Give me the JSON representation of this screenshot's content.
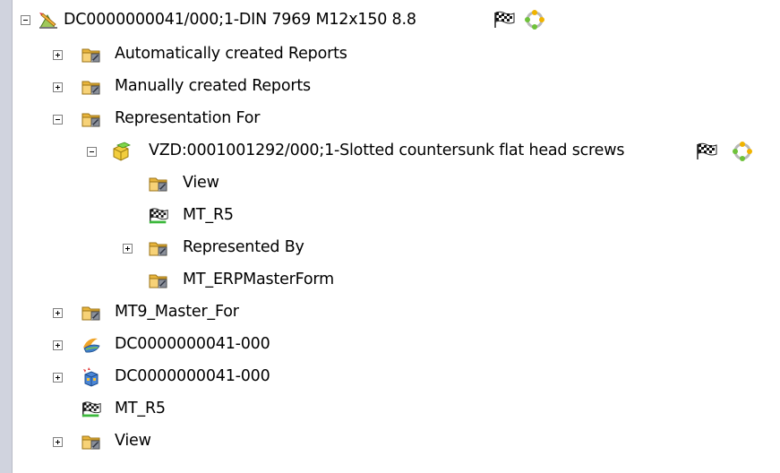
{
  "tree": {
    "root": {
      "label": "DC0000000041/000;1-DIN 7969 M12x150 8.8",
      "icons": [
        "edit-document-icon",
        "checkered-flag-icon",
        "lifecycle-ring-icon"
      ]
    },
    "items": [
      {
        "label": "Automatically created Reports",
        "icon": "folder-icon",
        "expander": "collapsed"
      },
      {
        "label": "Manually created Reports",
        "icon": "folder-icon",
        "expander": "collapsed"
      },
      {
        "label": "Representation For",
        "icon": "folder-icon",
        "expander": "expanded"
      },
      {
        "label": "VZD:0001001292/000;1-Slotted countersunk flat head screws",
        "icon": "part-cube-icon",
        "expander": "expanded"
      },
      {
        "label": "View",
        "icon": "folder-icon",
        "expander": "none"
      },
      {
        "label": "MT_R5",
        "icon": "checkered-flag-icon",
        "expander": "none"
      },
      {
        "label": "Represented By",
        "icon": "folder-icon",
        "expander": "collapsed"
      },
      {
        "label": "MT_ERPMasterForm",
        "icon": "folder-icon",
        "expander": "none"
      },
      {
        "label": "MT9_Master_For",
        "icon": "folder-icon",
        "expander": "collapsed"
      },
      {
        "label": "DC0000000041-000",
        "icon": "cad-model-icon",
        "expander": "collapsed"
      },
      {
        "label": "DC0000000041-000",
        "icon": "assembly-box-icon",
        "expander": "collapsed"
      },
      {
        "label": "MT_R5",
        "icon": "checkered-flag-icon",
        "expander": "none"
      },
      {
        "label": "View",
        "icon": "folder-icon",
        "expander": "collapsed"
      }
    ]
  },
  "colors": {
    "folder": "#f2c04a",
    "folder_dark": "#c99321",
    "window_bg": "#ffffff",
    "frame_bg": "#dcdfe8"
  }
}
